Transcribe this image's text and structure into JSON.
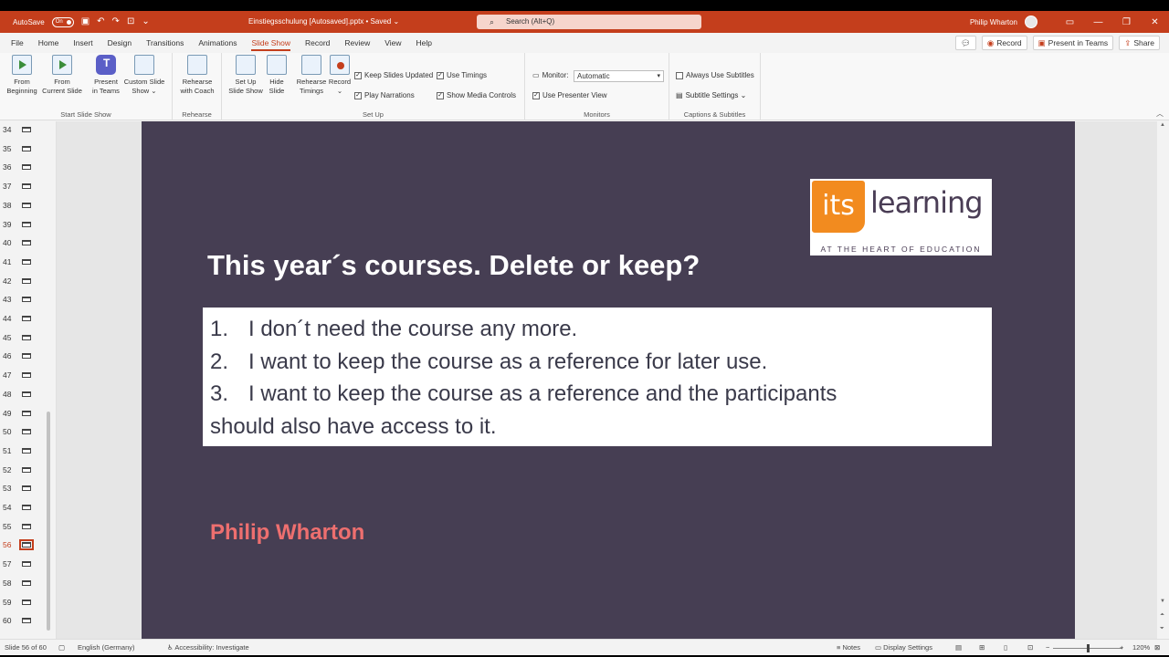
{
  "titlebar": {
    "autosave_label": "AutoSave",
    "autosave_state": "On",
    "doc_title": "Einstiegsschulung [Autosaved].pptx • Saved ⌄",
    "search_placeholder": "Search (Alt+Q)",
    "user_name": "Philip Wharton"
  },
  "tabs": [
    "File",
    "Home",
    "Insert",
    "Design",
    "Transitions",
    "Animations",
    "Slide Show",
    "Record",
    "Review",
    "View",
    "Help"
  ],
  "active_tab": "Slide Show",
  "tabs_right": {
    "record": "Record",
    "present_in_teams": "Present in Teams",
    "share": "Share"
  },
  "ribbon": {
    "start": {
      "label": "Start Slide Show",
      "from_beginning": [
        "From",
        "Beginning"
      ],
      "from_current": [
        "From",
        "Current Slide"
      ],
      "present_teams": [
        "Present",
        "in Teams"
      ],
      "custom": [
        "Custom Slide",
        "Show ⌄"
      ]
    },
    "rehearse": {
      "label": "Rehearse",
      "coach": [
        "Rehearse",
        "with Coach"
      ]
    },
    "setup": {
      "label": "Set Up",
      "setup_show": [
        "Set Up",
        "Slide Show"
      ],
      "hide_slide": [
        "Hide",
        "Slide"
      ],
      "rehearse_timings": [
        "Rehearse",
        "Timings"
      ],
      "record": [
        "Record",
        "⌄"
      ],
      "keep_updated": "Keep Slides Updated",
      "play_narrations": "Play Narrations",
      "use_timings": "Use Timings",
      "show_media": "Show Media Controls"
    },
    "monitors": {
      "label": "Monitors",
      "monitor_label": "Monitor:",
      "monitor_value": "Automatic",
      "presenter_view": "Use Presenter View"
    },
    "captions": {
      "label": "Captions & Subtitles",
      "always_subtitles": "Always Use Subtitles",
      "subtitle_settings": "Subtitle Settings ⌄"
    }
  },
  "thumbnails": {
    "numbers": [
      "34",
      "35",
      "36",
      "37",
      "38",
      "39",
      "40",
      "41",
      "42",
      "43",
      "44",
      "45",
      "46",
      "47",
      "48",
      "49",
      "50",
      "51",
      "52",
      "53",
      "54",
      "55",
      "56",
      "57",
      "58",
      "59",
      "60"
    ],
    "selected": "56"
  },
  "slide": {
    "title": "This year´s courses. Delete or keep?",
    "items": [
      {
        "num": "1.",
        "text": "I don´t need the course any more."
      },
      {
        "num": "2.",
        "text": "I want to keep the course as a reference for later use."
      },
      {
        "num": "3.",
        "text": "I want to keep the course as a reference and the participants"
      }
    ],
    "item3_cont": "should also have access to it.",
    "presenter": "Philip Wharton",
    "logo": {
      "mark": "its",
      "word": "learning",
      "tagline": "AT THE HEART OF EDUCATION"
    }
  },
  "status": {
    "slide_info": "Slide 56 of 60",
    "language": "English (Germany)",
    "accessibility": "Accessibility: Investigate",
    "notes": "Notes",
    "display_settings": "Display Settings",
    "zoom": "120%"
  },
  "colors": {
    "accent": "#c43e1c",
    "slide_bg": "#463e53",
    "presenter_name": "#ee6f6f",
    "logo_orange": "#f28b1f"
  }
}
